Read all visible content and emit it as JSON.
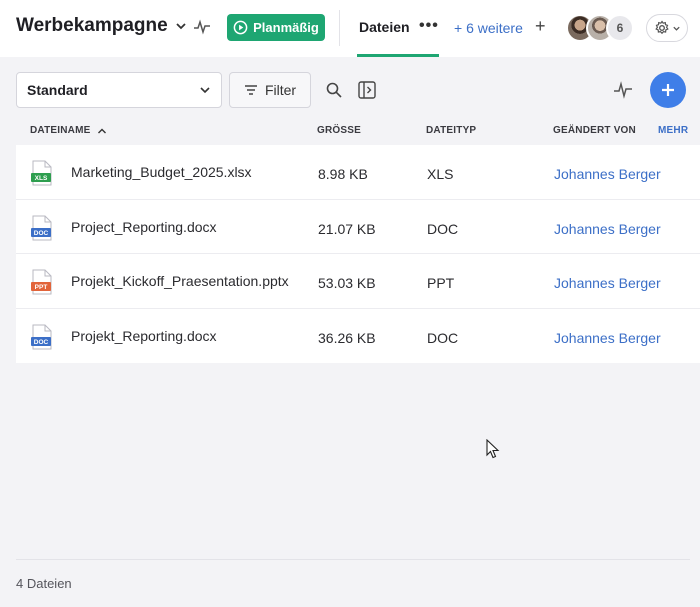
{
  "header": {
    "project_title": "Werbekampagne",
    "status_label": "Planmäßig",
    "active_tab": "Dateien",
    "more_tabs": "+ 6 weitere",
    "member_count": "6"
  },
  "toolbar": {
    "view_select": "Standard",
    "filter_label": "Filter"
  },
  "table": {
    "columns": {
      "name": "DATEINAME",
      "size": "GRÖSSE",
      "type": "DATEITYP",
      "modified_by": "GEÄNDERT VON",
      "more": "MEHR"
    },
    "rows": [
      {
        "icon_label": "XLS",
        "icon_color": "#2e9e4f",
        "name": "Marketing_Budget_2025.xlsx",
        "size": "8.98 KB",
        "type": "XLS",
        "modified_by": "Johannes Berger"
      },
      {
        "icon_label": "DOC",
        "icon_color": "#3c6fc7",
        "name": "Project_Reporting.docx",
        "size": "21.07 KB",
        "type": "DOC",
        "modified_by": "Johannes Berger"
      },
      {
        "icon_label": "PPT",
        "icon_color": "#e2643a",
        "name": "Projekt_Kickoff_Praesentation.pptx",
        "size": "53.03 KB",
        "type": "PPT",
        "modified_by": "Johannes Berger"
      },
      {
        "icon_label": "DOC",
        "icon_color": "#3c6fc7",
        "name": "Projekt_Reporting.docx",
        "size": "36.26 KB",
        "type": "DOC",
        "modified_by": "Johannes Berger"
      }
    ]
  },
  "footer": {
    "file_count": "4 Dateien"
  },
  "colors": {
    "accent_green": "#1ea672",
    "accent_blue": "#3f7ee8",
    "link_blue": "#3c6fc7"
  }
}
